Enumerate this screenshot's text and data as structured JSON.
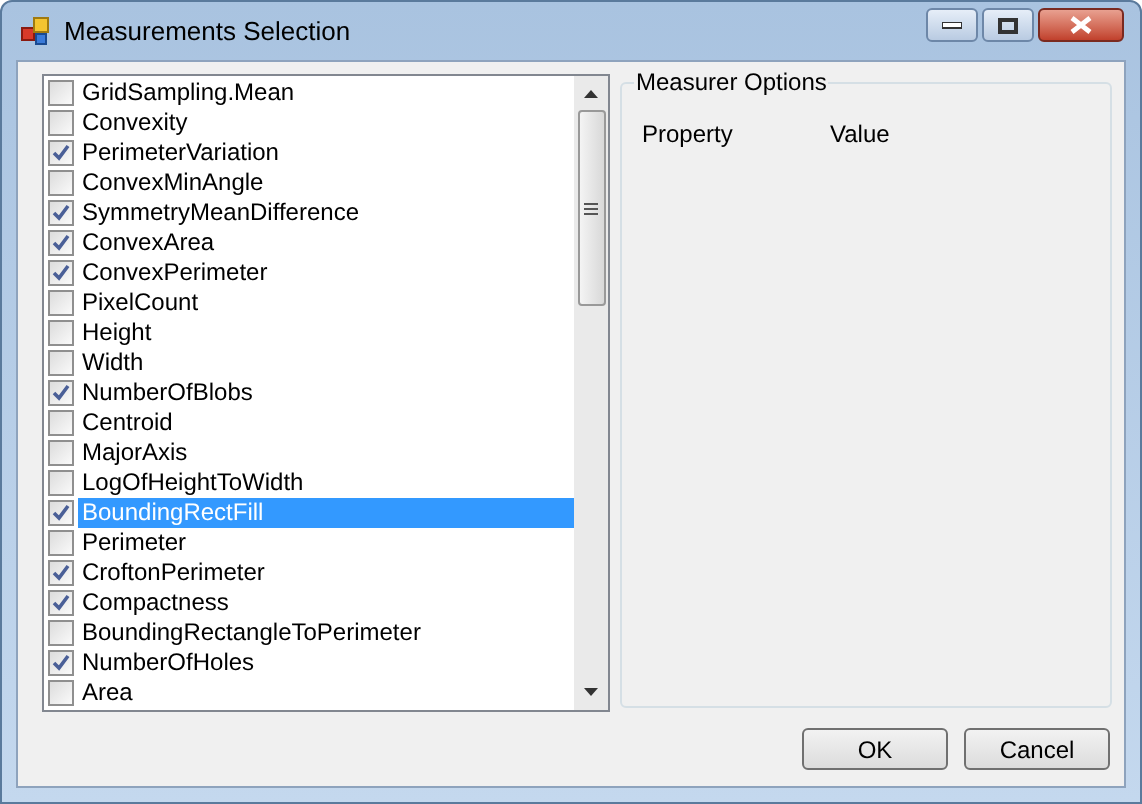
{
  "window": {
    "title": "Measurements Selection"
  },
  "measurements": [
    {
      "label": "GridSampling.Mean",
      "checked": false,
      "selected": false
    },
    {
      "label": "Convexity",
      "checked": false,
      "selected": false
    },
    {
      "label": "PerimeterVariation",
      "checked": true,
      "selected": false
    },
    {
      "label": "ConvexMinAngle",
      "checked": false,
      "selected": false
    },
    {
      "label": "SymmetryMeanDifference",
      "checked": true,
      "selected": false
    },
    {
      "label": "ConvexArea",
      "checked": true,
      "selected": false
    },
    {
      "label": "ConvexPerimeter",
      "checked": true,
      "selected": false
    },
    {
      "label": "PixelCount",
      "checked": false,
      "selected": false
    },
    {
      "label": "Height",
      "checked": false,
      "selected": false
    },
    {
      "label": "Width",
      "checked": false,
      "selected": false
    },
    {
      "label": "NumberOfBlobs",
      "checked": true,
      "selected": false
    },
    {
      "label": "Centroid",
      "checked": false,
      "selected": false
    },
    {
      "label": "MajorAxis",
      "checked": false,
      "selected": false
    },
    {
      "label": "LogOfHeightToWidth",
      "checked": false,
      "selected": false
    },
    {
      "label": "BoundingRectFill",
      "checked": true,
      "selected": true
    },
    {
      "label": "Perimeter",
      "checked": false,
      "selected": false
    },
    {
      "label": "CroftonPerimeter",
      "checked": true,
      "selected": false
    },
    {
      "label": "Compactness",
      "checked": true,
      "selected": false
    },
    {
      "label": "BoundingRectangleToPerimeter",
      "checked": false,
      "selected": false
    },
    {
      "label": "NumberOfHoles",
      "checked": true,
      "selected": false
    },
    {
      "label": "Area",
      "checked": false,
      "selected": false
    }
  ],
  "options": {
    "title": "Measurer Options",
    "columns": [
      "Property",
      "Value"
    ]
  },
  "buttons": [
    "OK",
    "Cancel"
  ]
}
